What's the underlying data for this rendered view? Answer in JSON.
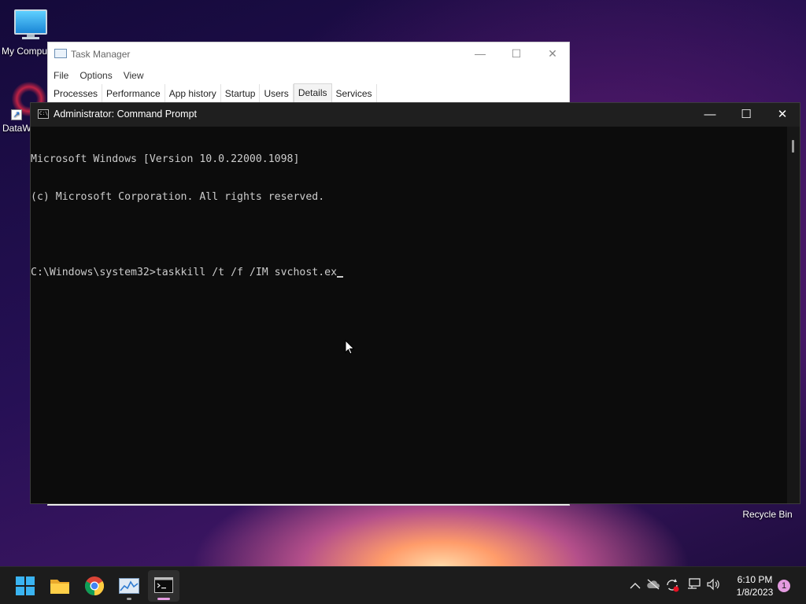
{
  "desktop": {
    "icons": [
      {
        "label": "My Compu"
      },
      {
        "label": "DataW"
      }
    ],
    "recycle_bin": "Recycle Bin"
  },
  "task_manager": {
    "title": "Task Manager",
    "menu": [
      "File",
      "Options",
      "View"
    ],
    "tabs": [
      "Processes",
      "Performance",
      "App history",
      "Startup",
      "Users",
      "Details",
      "Services"
    ],
    "active_tab": "Details"
  },
  "cmd": {
    "title": "Administrator: Command Prompt",
    "lines": [
      "Microsoft Windows [Version 10.0.22000.1098]",
      "(c) Microsoft Corporation. All rights reserved.",
      "",
      "C:\\Windows\\system32>taskkill /t /f /IM svchost.ex"
    ]
  },
  "taskbar": {
    "apps": [
      "start-icon",
      "file-explorer-icon",
      "chrome-icon",
      "task-manager-icon",
      "command-prompt-icon"
    ],
    "clock_time": "6:10 PM",
    "clock_date": "1/8/2023",
    "notification_count": "1",
    "colors": {
      "accent": "#e39be0",
      "taskbar": "#1c1c1c"
    }
  }
}
